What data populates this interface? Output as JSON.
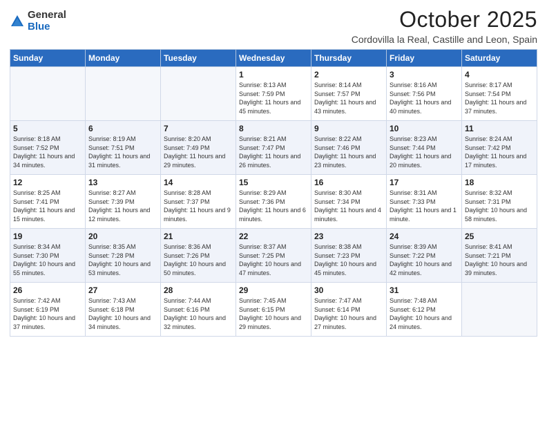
{
  "logo": {
    "general": "General",
    "blue": "Blue"
  },
  "header": {
    "month": "October 2025",
    "location": "Cordovilla la Real, Castille and Leon, Spain"
  },
  "days_of_week": [
    "Sunday",
    "Monday",
    "Tuesday",
    "Wednesday",
    "Thursday",
    "Friday",
    "Saturday"
  ],
  "weeks": [
    [
      {
        "day": "",
        "info": ""
      },
      {
        "day": "",
        "info": ""
      },
      {
        "day": "",
        "info": ""
      },
      {
        "day": "1",
        "info": "Sunrise: 8:13 AM\nSunset: 7:59 PM\nDaylight: 11 hours and 45 minutes."
      },
      {
        "day": "2",
        "info": "Sunrise: 8:14 AM\nSunset: 7:57 PM\nDaylight: 11 hours and 43 minutes."
      },
      {
        "day": "3",
        "info": "Sunrise: 8:16 AM\nSunset: 7:56 PM\nDaylight: 11 hours and 40 minutes."
      },
      {
        "day": "4",
        "info": "Sunrise: 8:17 AM\nSunset: 7:54 PM\nDaylight: 11 hours and 37 minutes."
      }
    ],
    [
      {
        "day": "5",
        "info": "Sunrise: 8:18 AM\nSunset: 7:52 PM\nDaylight: 11 hours and 34 minutes."
      },
      {
        "day": "6",
        "info": "Sunrise: 8:19 AM\nSunset: 7:51 PM\nDaylight: 11 hours and 31 minutes."
      },
      {
        "day": "7",
        "info": "Sunrise: 8:20 AM\nSunset: 7:49 PM\nDaylight: 11 hours and 29 minutes."
      },
      {
        "day": "8",
        "info": "Sunrise: 8:21 AM\nSunset: 7:47 PM\nDaylight: 11 hours and 26 minutes."
      },
      {
        "day": "9",
        "info": "Sunrise: 8:22 AM\nSunset: 7:46 PM\nDaylight: 11 hours and 23 minutes."
      },
      {
        "day": "10",
        "info": "Sunrise: 8:23 AM\nSunset: 7:44 PM\nDaylight: 11 hours and 20 minutes."
      },
      {
        "day": "11",
        "info": "Sunrise: 8:24 AM\nSunset: 7:42 PM\nDaylight: 11 hours and 17 minutes."
      }
    ],
    [
      {
        "day": "12",
        "info": "Sunrise: 8:25 AM\nSunset: 7:41 PM\nDaylight: 11 hours and 15 minutes."
      },
      {
        "day": "13",
        "info": "Sunrise: 8:27 AM\nSunset: 7:39 PM\nDaylight: 11 hours and 12 minutes."
      },
      {
        "day": "14",
        "info": "Sunrise: 8:28 AM\nSunset: 7:37 PM\nDaylight: 11 hours and 9 minutes."
      },
      {
        "day": "15",
        "info": "Sunrise: 8:29 AM\nSunset: 7:36 PM\nDaylight: 11 hours and 6 minutes."
      },
      {
        "day": "16",
        "info": "Sunrise: 8:30 AM\nSunset: 7:34 PM\nDaylight: 11 hours and 4 minutes."
      },
      {
        "day": "17",
        "info": "Sunrise: 8:31 AM\nSunset: 7:33 PM\nDaylight: 11 hours and 1 minute."
      },
      {
        "day": "18",
        "info": "Sunrise: 8:32 AM\nSunset: 7:31 PM\nDaylight: 10 hours and 58 minutes."
      }
    ],
    [
      {
        "day": "19",
        "info": "Sunrise: 8:34 AM\nSunset: 7:30 PM\nDaylight: 10 hours and 55 minutes."
      },
      {
        "day": "20",
        "info": "Sunrise: 8:35 AM\nSunset: 7:28 PM\nDaylight: 10 hours and 53 minutes."
      },
      {
        "day": "21",
        "info": "Sunrise: 8:36 AM\nSunset: 7:26 PM\nDaylight: 10 hours and 50 minutes."
      },
      {
        "day": "22",
        "info": "Sunrise: 8:37 AM\nSunset: 7:25 PM\nDaylight: 10 hours and 47 minutes."
      },
      {
        "day": "23",
        "info": "Sunrise: 8:38 AM\nSunset: 7:23 PM\nDaylight: 10 hours and 45 minutes."
      },
      {
        "day": "24",
        "info": "Sunrise: 8:39 AM\nSunset: 7:22 PM\nDaylight: 10 hours and 42 minutes."
      },
      {
        "day": "25",
        "info": "Sunrise: 8:41 AM\nSunset: 7:21 PM\nDaylight: 10 hours and 39 minutes."
      }
    ],
    [
      {
        "day": "26",
        "info": "Sunrise: 7:42 AM\nSunset: 6:19 PM\nDaylight: 10 hours and 37 minutes."
      },
      {
        "day": "27",
        "info": "Sunrise: 7:43 AM\nSunset: 6:18 PM\nDaylight: 10 hours and 34 minutes."
      },
      {
        "day": "28",
        "info": "Sunrise: 7:44 AM\nSunset: 6:16 PM\nDaylight: 10 hours and 32 minutes."
      },
      {
        "day": "29",
        "info": "Sunrise: 7:45 AM\nSunset: 6:15 PM\nDaylight: 10 hours and 29 minutes."
      },
      {
        "day": "30",
        "info": "Sunrise: 7:47 AM\nSunset: 6:14 PM\nDaylight: 10 hours and 27 minutes."
      },
      {
        "day": "31",
        "info": "Sunrise: 7:48 AM\nSunset: 6:12 PM\nDaylight: 10 hours and 24 minutes."
      },
      {
        "day": "",
        "info": ""
      }
    ]
  ]
}
